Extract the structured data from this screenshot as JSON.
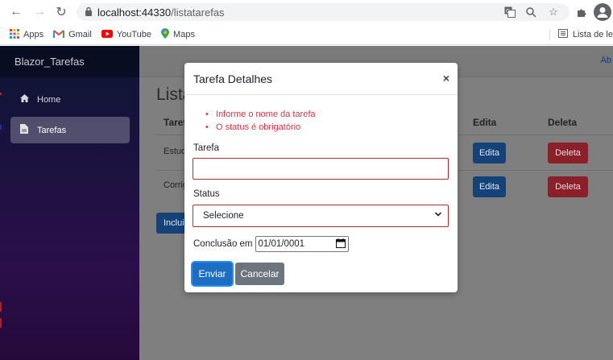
{
  "browser": {
    "url_host": "localhost:44330",
    "url_path": "/listatarefas",
    "bookmarks": [
      {
        "label": "Apps",
        "icon": "apps-grid-icon"
      },
      {
        "label": "Gmail",
        "icon": "gmail-icon"
      },
      {
        "label": "YouTube",
        "icon": "youtube-icon"
      },
      {
        "label": "Maps",
        "icon": "maps-icon"
      }
    ],
    "reading_list_label": "Lista de le"
  },
  "app": {
    "brand": "Blazor_Tarefas",
    "about_label": "Ab",
    "nav": [
      {
        "label": "Home",
        "icon": "home-icon",
        "active": false
      },
      {
        "label": "Tarefas",
        "icon": "document-icon",
        "active": true
      }
    ],
    "page_title": "Lista",
    "table": {
      "headers": {
        "task": "Taref",
        "edit": "Edita",
        "delete": "Deleta"
      },
      "rows": [
        {
          "task": "Estud",
          "edit": "Edita",
          "delete": "Deleta"
        },
        {
          "task": "Corrig",
          "edit": "Edita",
          "delete": "Deleta"
        }
      ]
    },
    "include_button": "Inclui"
  },
  "modal": {
    "title": "Tarefa Detalhes",
    "close_glyph": "×",
    "errors": [
      "Informe o nome da tarefa",
      "O status é obrigatório"
    ],
    "task_label": "Tarefa",
    "task_value": "",
    "status_label": "Status",
    "status_value": "Selecione",
    "date_label": "Conclusão em",
    "date_value": "01/01/0001",
    "submit_label": "Enviar",
    "cancel_label": "Cancelar"
  },
  "colors": {
    "primary": "#1b6ec2",
    "danger": "#dc3545",
    "secondary": "#6c757d"
  }
}
